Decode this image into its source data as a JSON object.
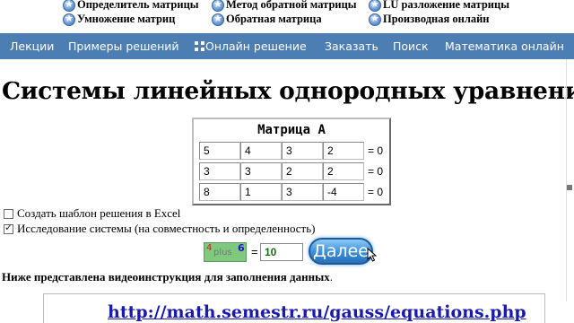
{
  "top_links": [
    {
      "label": "Определитель матрицы"
    },
    {
      "label": "Метод обратной матрицы"
    },
    {
      "label": "LU разложение матрицы"
    },
    {
      "label": "Умножение матриц"
    },
    {
      "label": "Обратная матрица"
    },
    {
      "label": "Производная онлайн"
    }
  ],
  "nav": {
    "items": [
      "Лекции",
      "Примеры решений",
      "Онлайн решение",
      "Заказать",
      "Поиск",
      "Математика онлайн"
    ],
    "background": "#4c7db3"
  },
  "page_title": "Системы линейных однородных уравнений",
  "matrix": {
    "title": "Матрица A",
    "rows": [
      {
        "cells": [
          "5",
          "4",
          "3",
          "2"
        ],
        "rhs": "= 0"
      },
      {
        "cells": [
          "3",
          "3",
          "2",
          "2"
        ],
        "rhs": "= 0"
      },
      {
        "cells": [
          "8",
          "1",
          "3",
          "-4"
        ],
        "rhs": "= 0"
      }
    ]
  },
  "options": {
    "excel_template": {
      "label": "Создать шаблон решения в Excel",
      "checked": false
    },
    "investigate": {
      "label": "Исследование системы (на совместность и определенность)",
      "checked": true
    }
  },
  "captcha": {
    "a": "4",
    "op": "plus",
    "b": "6",
    "equals": "=",
    "answer": "10"
  },
  "submit_label": "Далее",
  "note": {
    "bold": "Ниже представлена видеоинструкция для заполнения данных",
    "tail": "."
  },
  "video_link": "http://math.semestr.ru/gauss/equations.php",
  "icons": {
    "top_link": "star-icon",
    "nav_online": "grid-icon"
  }
}
